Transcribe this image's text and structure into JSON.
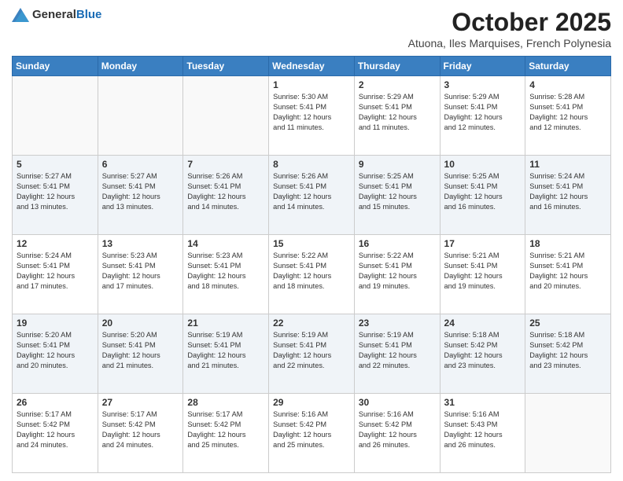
{
  "logo": {
    "general": "General",
    "blue": "Blue"
  },
  "header": {
    "month_year": "October 2025",
    "location": "Atuona, Iles Marquises, French Polynesia"
  },
  "weekdays": [
    "Sunday",
    "Monday",
    "Tuesday",
    "Wednesday",
    "Thursday",
    "Friday",
    "Saturday"
  ],
  "weeks": [
    [
      {
        "day": "",
        "info": ""
      },
      {
        "day": "",
        "info": ""
      },
      {
        "day": "",
        "info": ""
      },
      {
        "day": "1",
        "info": "Sunrise: 5:30 AM\nSunset: 5:41 PM\nDaylight: 12 hours\nand 11 minutes."
      },
      {
        "day": "2",
        "info": "Sunrise: 5:29 AM\nSunset: 5:41 PM\nDaylight: 12 hours\nand 11 minutes."
      },
      {
        "day": "3",
        "info": "Sunrise: 5:29 AM\nSunset: 5:41 PM\nDaylight: 12 hours\nand 12 minutes."
      },
      {
        "day": "4",
        "info": "Sunrise: 5:28 AM\nSunset: 5:41 PM\nDaylight: 12 hours\nand 12 minutes."
      }
    ],
    [
      {
        "day": "5",
        "info": "Sunrise: 5:27 AM\nSunset: 5:41 PM\nDaylight: 12 hours\nand 13 minutes."
      },
      {
        "day": "6",
        "info": "Sunrise: 5:27 AM\nSunset: 5:41 PM\nDaylight: 12 hours\nand 13 minutes."
      },
      {
        "day": "7",
        "info": "Sunrise: 5:26 AM\nSunset: 5:41 PM\nDaylight: 12 hours\nand 14 minutes."
      },
      {
        "day": "8",
        "info": "Sunrise: 5:26 AM\nSunset: 5:41 PM\nDaylight: 12 hours\nand 14 minutes."
      },
      {
        "day": "9",
        "info": "Sunrise: 5:25 AM\nSunset: 5:41 PM\nDaylight: 12 hours\nand 15 minutes."
      },
      {
        "day": "10",
        "info": "Sunrise: 5:25 AM\nSunset: 5:41 PM\nDaylight: 12 hours\nand 16 minutes."
      },
      {
        "day": "11",
        "info": "Sunrise: 5:24 AM\nSunset: 5:41 PM\nDaylight: 12 hours\nand 16 minutes."
      }
    ],
    [
      {
        "day": "12",
        "info": "Sunrise: 5:24 AM\nSunset: 5:41 PM\nDaylight: 12 hours\nand 17 minutes."
      },
      {
        "day": "13",
        "info": "Sunrise: 5:23 AM\nSunset: 5:41 PM\nDaylight: 12 hours\nand 17 minutes."
      },
      {
        "day": "14",
        "info": "Sunrise: 5:23 AM\nSunset: 5:41 PM\nDaylight: 12 hours\nand 18 minutes."
      },
      {
        "day": "15",
        "info": "Sunrise: 5:22 AM\nSunset: 5:41 PM\nDaylight: 12 hours\nand 18 minutes."
      },
      {
        "day": "16",
        "info": "Sunrise: 5:22 AM\nSunset: 5:41 PM\nDaylight: 12 hours\nand 19 minutes."
      },
      {
        "day": "17",
        "info": "Sunrise: 5:21 AM\nSunset: 5:41 PM\nDaylight: 12 hours\nand 19 minutes."
      },
      {
        "day": "18",
        "info": "Sunrise: 5:21 AM\nSunset: 5:41 PM\nDaylight: 12 hours\nand 20 minutes."
      }
    ],
    [
      {
        "day": "19",
        "info": "Sunrise: 5:20 AM\nSunset: 5:41 PM\nDaylight: 12 hours\nand 20 minutes."
      },
      {
        "day": "20",
        "info": "Sunrise: 5:20 AM\nSunset: 5:41 PM\nDaylight: 12 hours\nand 21 minutes."
      },
      {
        "day": "21",
        "info": "Sunrise: 5:19 AM\nSunset: 5:41 PM\nDaylight: 12 hours\nand 21 minutes."
      },
      {
        "day": "22",
        "info": "Sunrise: 5:19 AM\nSunset: 5:41 PM\nDaylight: 12 hours\nand 22 minutes."
      },
      {
        "day": "23",
        "info": "Sunrise: 5:19 AM\nSunset: 5:41 PM\nDaylight: 12 hours\nand 22 minutes."
      },
      {
        "day": "24",
        "info": "Sunrise: 5:18 AM\nSunset: 5:42 PM\nDaylight: 12 hours\nand 23 minutes."
      },
      {
        "day": "25",
        "info": "Sunrise: 5:18 AM\nSunset: 5:42 PM\nDaylight: 12 hours\nand 23 minutes."
      }
    ],
    [
      {
        "day": "26",
        "info": "Sunrise: 5:17 AM\nSunset: 5:42 PM\nDaylight: 12 hours\nand 24 minutes."
      },
      {
        "day": "27",
        "info": "Sunrise: 5:17 AM\nSunset: 5:42 PM\nDaylight: 12 hours\nand 24 minutes."
      },
      {
        "day": "28",
        "info": "Sunrise: 5:17 AM\nSunset: 5:42 PM\nDaylight: 12 hours\nand 25 minutes."
      },
      {
        "day": "29",
        "info": "Sunrise: 5:16 AM\nSunset: 5:42 PM\nDaylight: 12 hours\nand 25 minutes."
      },
      {
        "day": "30",
        "info": "Sunrise: 5:16 AM\nSunset: 5:42 PM\nDaylight: 12 hours\nand 26 minutes."
      },
      {
        "day": "31",
        "info": "Sunrise: 5:16 AM\nSunset: 5:43 PM\nDaylight: 12 hours\nand 26 minutes."
      },
      {
        "day": "",
        "info": ""
      }
    ]
  ]
}
